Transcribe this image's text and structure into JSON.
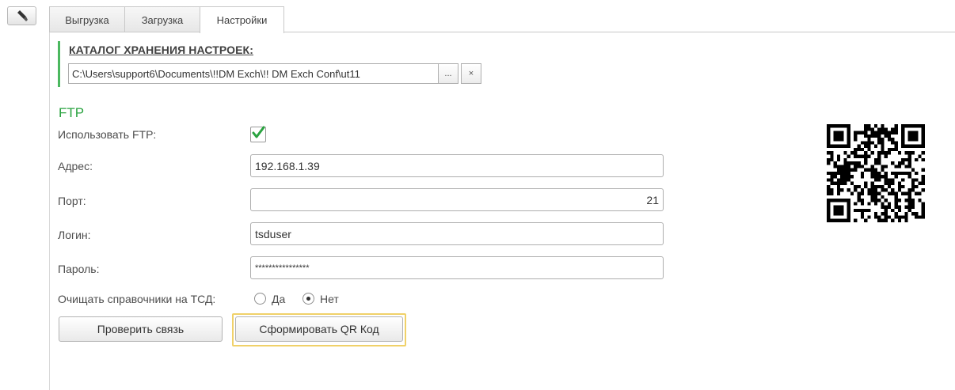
{
  "tabs": [
    {
      "label": "Выгрузка",
      "active": false
    },
    {
      "label": "Загрузка",
      "active": false
    },
    {
      "label": "Настройки",
      "active": true
    }
  ],
  "catalog": {
    "title": "КАТАЛОГ ХРАНЕНИЯ НАСТРОЕК:",
    "path": "C:\\Users\\support6\\Documents\\!!DM Exch\\!! DM Exch Conf\\ut11",
    "browse_label": "...",
    "clear_label": "×"
  },
  "ftp": {
    "title": "FTP",
    "use_label": "Использовать FTP:",
    "use_checked": true,
    "address_label": "Адрес:",
    "address_value": "192.168.1.39",
    "port_label": "Порт:",
    "port_value": "21",
    "login_label": "Логин:",
    "login_value": "tsduser",
    "password_label": "Пароль:",
    "password_value": "****************"
  },
  "clear_refs": {
    "label": "Очищать справочники на ТСД:",
    "options": [
      "Да",
      "Нет"
    ],
    "selected": "Нет"
  },
  "buttons": {
    "check_label": "Проверить связь",
    "qr_label": "Сформировать QR Код"
  },
  "colors": {
    "accent_green": "#2aa340",
    "focus_yellow": "#f0d169"
  },
  "icons": {
    "tool": "brush-icon",
    "check": "checkmark-icon",
    "qr": "qr-code-icon"
  }
}
